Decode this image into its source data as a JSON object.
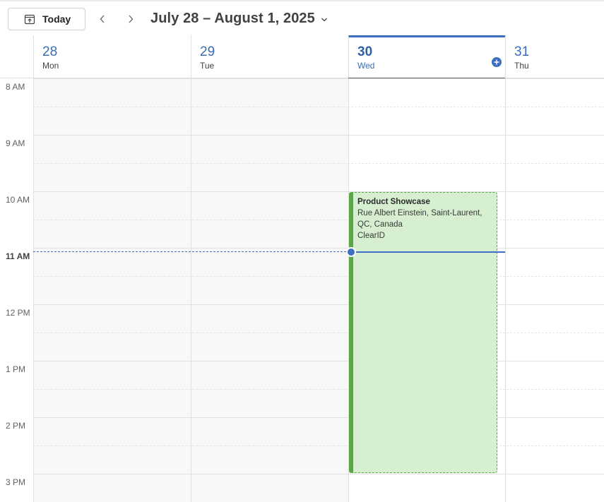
{
  "toolbar": {
    "today_label": "Today",
    "date_range": "July 28 – August 1, 2025"
  },
  "days": [
    {
      "num": "28",
      "name": "Mon",
      "today": false
    },
    {
      "num": "29",
      "name": "Tue",
      "today": false
    },
    {
      "num": "30",
      "name": "Wed",
      "today": true
    },
    {
      "num": "31",
      "name": "Thu",
      "today": false
    }
  ],
  "times": [
    "8 AM",
    "9 AM",
    "10 AM",
    "11 AM",
    "12 PM",
    "1 PM",
    "2 PM",
    "3 PM"
  ],
  "current_time_label": "11 AM",
  "event": {
    "title": "Product Showcase",
    "location_line1": "Rue Albert Einstein, Saint-Laurent,",
    "location_line2": "QC, Canada",
    "organizer": "ClearID",
    "color": "#5aa746"
  },
  "accent_color": "#3c6fbf"
}
